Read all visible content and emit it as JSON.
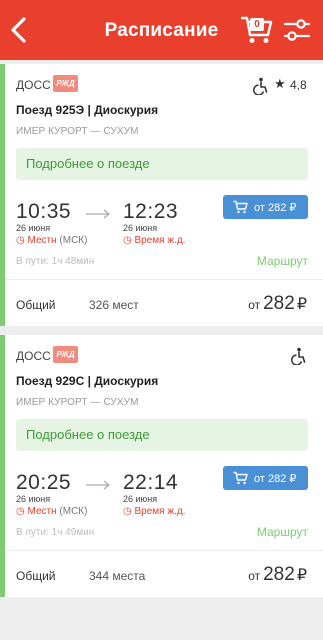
{
  "header": {
    "title": "Расписание",
    "cart_count": "0",
    "colors": {
      "brand": "#e8402d",
      "accent_green": "#7fcb73",
      "button_blue": "#4a90d6"
    }
  },
  "trains": [
    {
      "carrier": "ДОСС",
      "carrier_logo": "РЖД",
      "rating": "4,8",
      "name": "Поезд 925Э | Диоскурия",
      "route": "ИМЕР КУРОРТ — СУХУМ",
      "details_label": "Подробнее о поезде",
      "departure_time": "10:35",
      "arrival_time": "12:23",
      "departure_date": "26 июня",
      "arrival_date": "26 июня",
      "departure_tz_local": "Местн",
      "departure_tz_msk": " (МСК)",
      "arrival_tz": "Время ж.д.",
      "buy_label": "от 282 ₽",
      "duration": "В пути: 1ч 48мин",
      "route_link": "Маршрут",
      "class_name": "Общий",
      "seats": "326 мест",
      "price_from": "от",
      "price_amount": "282",
      "price_currency": "₽"
    },
    {
      "carrier": "ДОСС",
      "carrier_logo": "РЖД",
      "name": "Поезд 929С | Диоскурия",
      "route": "ИМЕР КУРОРТ — СУХУМ",
      "details_label": "Подробнее о поезде",
      "departure_time": "20:25",
      "arrival_time": "22:14",
      "departure_date": "26 июня",
      "arrival_date": "26 июня",
      "departure_tz_local": "Местн",
      "departure_tz_msk": " (МСК)",
      "arrival_tz": "Время ж.д.",
      "buy_label": "от 282 ₽",
      "duration": "В пути: 1ч 49мин",
      "route_link": "Маршрут",
      "class_name": "Общий",
      "seats": "344 места",
      "price_from": "от",
      "price_amount": "282",
      "price_currency": "₽"
    }
  ]
}
